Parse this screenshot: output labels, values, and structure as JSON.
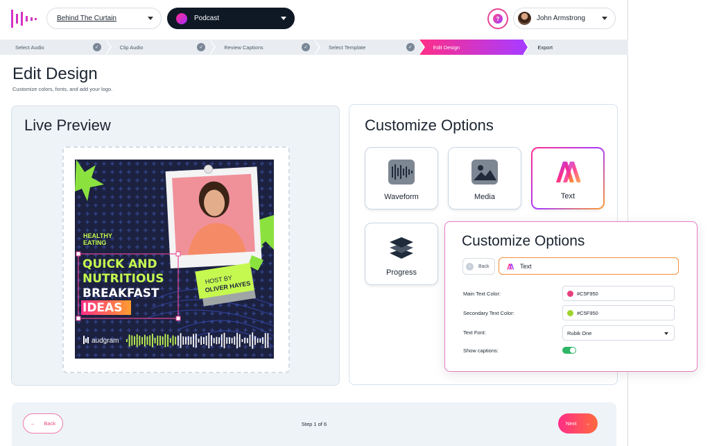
{
  "header": {
    "project": "Behind The Curtain",
    "type": "Podcast",
    "help": "?",
    "user": "John Armstrong"
  },
  "steps": [
    {
      "label": "Select Audio",
      "done": true
    },
    {
      "label": "Clip Audio",
      "done": true
    },
    {
      "label": "Review Captions",
      "done": true
    },
    {
      "label": "Select Template",
      "done": true
    },
    {
      "label": "Edit Design",
      "active": true
    },
    {
      "label": "Export"
    }
  ],
  "page": {
    "title": "Edit Design",
    "subtitle": "Customize colors, fonts, and add your logo."
  },
  "preview": {
    "title": "Live Preview",
    "art": {
      "tag1": "HEALTHY",
      "tag2": "EATING",
      "line1": "QUICK AND",
      "line2": "NUTRITIOUS",
      "line3": "BREAKFAST",
      "line4": "IDEAS",
      "host1": "HOST BY",
      "host2": "OLIVER HAYES",
      "brand": "audgram"
    }
  },
  "options": {
    "title": "Customize Options",
    "items": [
      {
        "label": "Waveform"
      },
      {
        "label": "Media"
      },
      {
        "label": "Text"
      },
      {
        "label": "Progress"
      }
    ]
  },
  "popup": {
    "title": "Customize Options",
    "back": "Back",
    "field": "Text",
    "main_label": "Main Text Color:",
    "main_value": "#C5F950",
    "secondary_label": "Secondary Text Color:",
    "secondary_value": "#C5F950",
    "font_label": "Text Font:",
    "font_value": "Rubik One",
    "captions_label": "Show captions:"
  },
  "footer": {
    "back": "Back",
    "step": "Step 1 of 6",
    "next": "Next"
  },
  "colors": {
    "accent": "#ff2e87",
    "lime": "#c5f950",
    "dark": "#0f1926"
  }
}
